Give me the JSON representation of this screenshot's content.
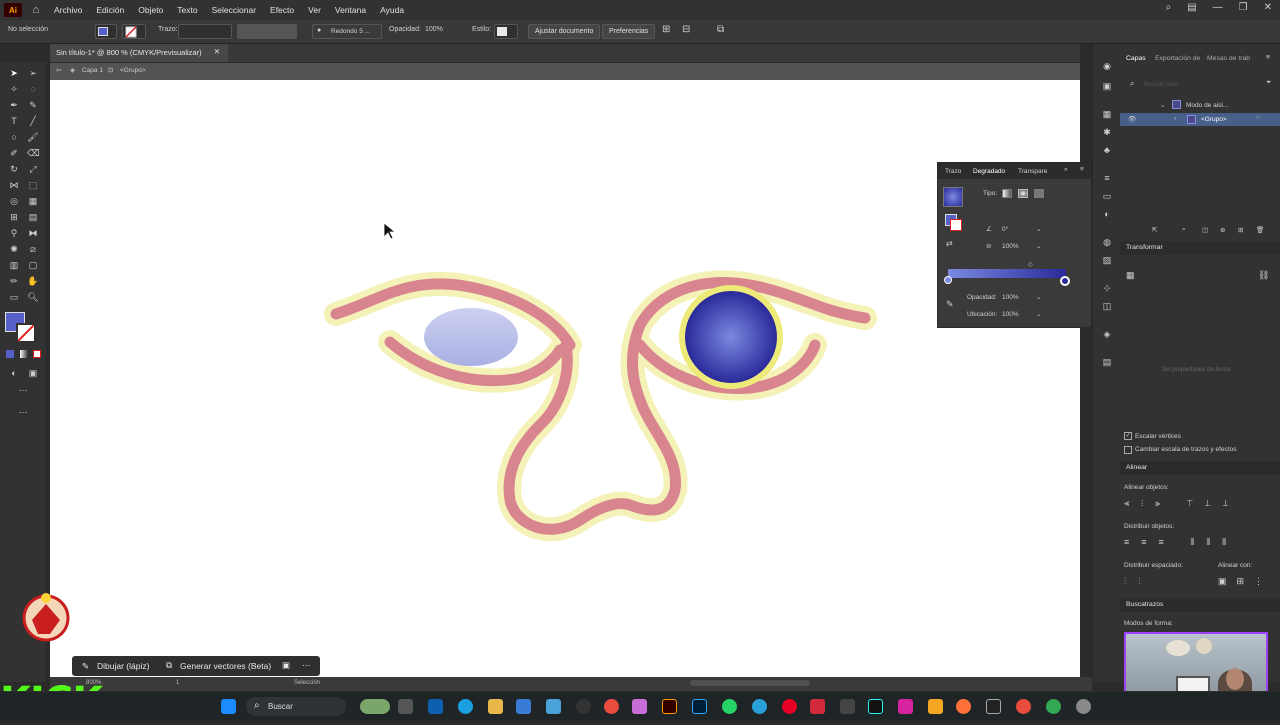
{
  "app": {
    "logo": "Ai",
    "menus": [
      "Archivo",
      "Edición",
      "Objeto",
      "Texto",
      "Seleccionar",
      "Efecto",
      "Ver",
      "Ventana",
      "Ayuda"
    ]
  },
  "control_bar": {
    "selection": "No selección",
    "stroke_label": "Trazo:",
    "brush": "Redondo 5 ...",
    "opacity_label": "Opacidad:",
    "opacity_value": "100%",
    "style_label": "Estilo:",
    "doc_setup": "Ajustar documento",
    "prefs": "Preferencias"
  },
  "document": {
    "tab_title": "Sin título-1* @ 800 % (CMYK/Previsualizar)",
    "crumb_layer": "Capa 1",
    "crumb_group": "<Grupo>"
  },
  "gradient_panel": {
    "tab_stroke": "Trazo",
    "tab_gradient": "Degradado",
    "tab_transparency": "Transpare",
    "type_label": "Tipo:",
    "angle": "0°",
    "aspect": "100%",
    "opacity_label": "Opacidad:",
    "opacity_value": "100%",
    "location_label": "Ubicación:",
    "location_value": "100%"
  },
  "layers_panel": {
    "tabs": [
      "Capas",
      "Exportación de",
      "Mesas de trab"
    ],
    "search_placeholder": "Buscar todo",
    "row1": "Modo de aisl...",
    "row2": "<Grupo>"
  },
  "transform_panel": {
    "title": "Transformar",
    "no_props": "Sin propiedades de forma",
    "scale_corners": "Escalar vértices",
    "scale_strokes": "Cambiar escala de trazos y efectos"
  },
  "align_panel": {
    "title": "Alinear",
    "align_objects": "Alinear objetos:",
    "distribute_objects": "Distribuir objetos:",
    "distribute_spacing": "Distribuir espaciado:",
    "align_to": "Alinear con:"
  },
  "pathfinder_panel": {
    "title": "Buscatrazos",
    "shape_modes": "Modos de forma:"
  },
  "context_bar": {
    "draw": "Dibujar (lápiz)",
    "generate": "Generar vectores (Beta)"
  },
  "status_bar": {
    "zoom": "800%",
    "page": "1",
    "tool": "Selección"
  },
  "taskbar": {
    "search": "Buscar"
  },
  "overlay": {
    "stream_brand": "KICK"
  },
  "colors": {
    "gradient_start": "#7a8ae0",
    "gradient_end": "#2a2a9a",
    "eye_outline": "#f3f1b0",
    "eye_stroke": "#d9858f",
    "kick_green": "#53fc18"
  }
}
